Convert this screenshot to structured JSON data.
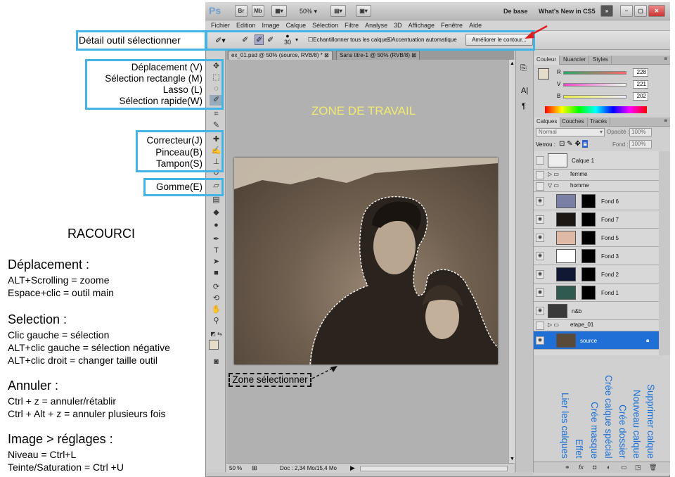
{
  "app": {
    "logo": "Ps",
    "bar_buttons": [
      "Br",
      "Mb"
    ],
    "zoom": "50%",
    "workspace": "De base",
    "whats_new": "What's New in CS5"
  },
  "menu": [
    "Fichier",
    "Edition",
    "Image",
    "Calque",
    "Sélection",
    "Filtre",
    "Analyse",
    "3D",
    "Affichage",
    "Fenêtre",
    "Aide"
  ],
  "options": {
    "brush_size": "30",
    "sample_all": "Echantillonner tous les calques",
    "auto_enhance": "Accentuation automatique",
    "refine_button": "Améliorer le contour..."
  },
  "doc_tabs": [
    "ex_01.psd @ 50% (source, RVB/8) *",
    "Sans titre-1 @ 50% (RVB/8)"
  ],
  "status": {
    "zoom": "50 %",
    "doc": "Doc : 2,34 Mo/15,4 Mo"
  },
  "color_panel": {
    "tabs": [
      "Couleur",
      "Nuancier",
      "Styles"
    ],
    "r_label": "R",
    "v_label": "V",
    "b_label": "B",
    "r": "228",
    "v": "221",
    "b": "202"
  },
  "layers_panel": {
    "tabs": [
      "Calques",
      "Couches",
      "Tracés"
    ],
    "blend": "Normal",
    "opacity_label": "Opacité :",
    "opacity": "100%",
    "lock_label": "Verrou :",
    "fill_label": "Fond :",
    "fill": "100%"
  },
  "layers": [
    {
      "name": "Calque 1",
      "kind": "layer"
    },
    {
      "name": "femme",
      "kind": "group"
    },
    {
      "name": "homme",
      "kind": "group-open"
    },
    {
      "name": "Fond 6",
      "kind": "masked"
    },
    {
      "name": "Fond 7",
      "kind": "masked"
    },
    {
      "name": "Fond 5",
      "kind": "masked"
    },
    {
      "name": "Fond 3",
      "kind": "masked"
    },
    {
      "name": "Fond 2",
      "kind": "masked"
    },
    {
      "name": "Fond 1",
      "kind": "masked"
    },
    {
      "name": "n&b",
      "kind": "layer"
    },
    {
      "name": "etape_01",
      "kind": "group"
    },
    {
      "name": "source",
      "kind": "selected"
    }
  ],
  "annotations": {
    "tool_detail": "Détail outil sélectionner",
    "tools_group1": [
      "Déplacement (V)",
      "Sélection rectangle (M)",
      "Lasso (L)",
      "Sélection rapide(W)"
    ],
    "tools_group2": [
      "Correcteur(J)",
      "Pinceau(B)",
      "Tampon(S)"
    ],
    "tools_group3": [
      "Gomme(E)"
    ],
    "work_zone": "ZONE DE TRAVAIL",
    "selection_zone": "Zone sélectionner",
    "layer_buttons": [
      "Lier les calques",
      "Effet",
      "Crée masque",
      "Crée calque spécial",
      "Crée dossier",
      "Nouveau calque",
      "Supprimer calque"
    ]
  },
  "shortcuts": {
    "title": "RACOURCI",
    "sections": [
      {
        "head": "Déplacement :",
        "lines": [
          "ALT+Scrolling = zoome",
          "Espace+clic = outil main"
        ]
      },
      {
        "head": "Selection :",
        "lines": [
          "Clic gauche = sélection",
          "ALT+clic gauche = sélection négative",
          "ALT+clic droit = changer taille outil"
        ]
      },
      {
        "head": "Annuler :",
        "lines": [
          "Ctrl + z = annuler/rétablir",
          "Ctrl + Alt + z = annuler plusieurs fois"
        ]
      },
      {
        "head": "Image > réglages :",
        "lines": [
          "Niveau = Ctrl+L",
          "Teinte/Saturation = Ctrl +U"
        ]
      }
    ]
  },
  "colors": {
    "annotation_blue": "#42b4e6",
    "label_blue": "#1b6fd6",
    "zone_yellow": "#f2ea6e",
    "arrow_red": "#e02020"
  }
}
